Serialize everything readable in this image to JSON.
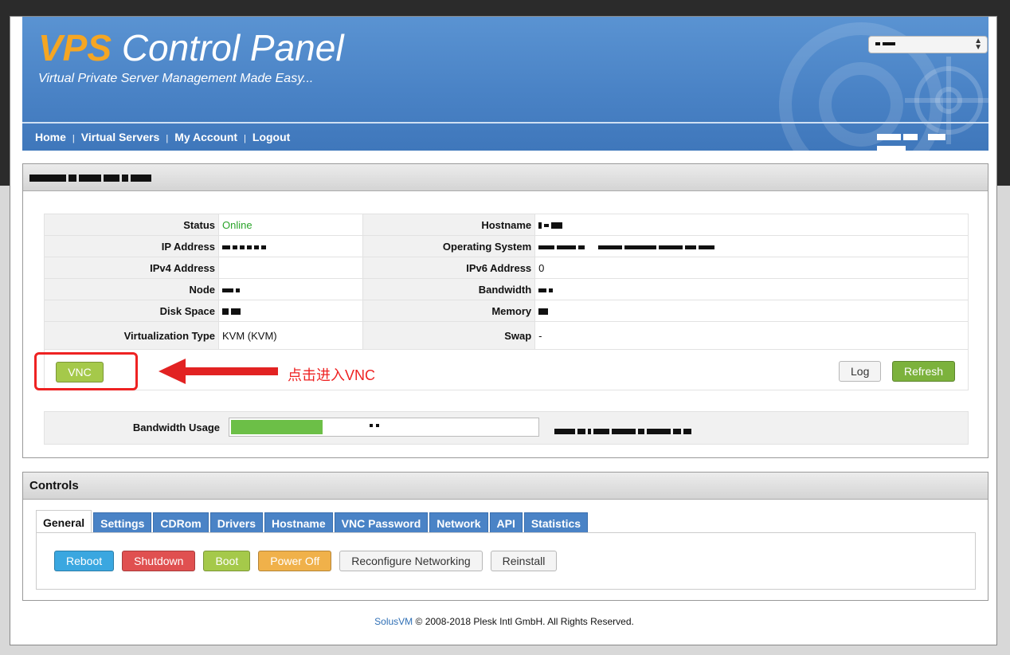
{
  "header": {
    "title_prefix": "VPS",
    "title_rest": " Control Panel",
    "subtitle": "Virtual Private Server Management Made Easy..."
  },
  "nav": {
    "items": [
      "Home",
      "Virtual Servers",
      "My Account",
      "Logout"
    ]
  },
  "server": {
    "left": [
      {
        "label": "Status",
        "value": "Online"
      },
      {
        "label": "IP Address",
        "value": ""
      },
      {
        "label": "IPv4 Address",
        "value": ""
      },
      {
        "label": "Node",
        "value": ""
      },
      {
        "label": "Disk Space",
        "value": ""
      },
      {
        "label": "Virtualization Type",
        "value": "KVM  (KVM)"
      }
    ],
    "right": [
      {
        "label": "Hostname",
        "value": ""
      },
      {
        "label": "Operating System",
        "value": ""
      },
      {
        "label": "IPv6 Address",
        "value": "0"
      },
      {
        "label": "Bandwidth",
        "value": ""
      },
      {
        "label": "Memory",
        "value": ""
      },
      {
        "label": "Swap",
        "value": "-"
      }
    ],
    "vnc_label": "VNC",
    "log_label": "Log",
    "refresh_label": "Refresh",
    "annotation": "点击进入VNC",
    "bandwidth_label": "Bandwidth Usage",
    "bandwidth_percent": 30
  },
  "controls": {
    "title": "Controls",
    "tabs": [
      "General",
      "Settings",
      "CDRom",
      "Drivers",
      "Hostname",
      "VNC Password",
      "Network",
      "API",
      "Statistics"
    ],
    "buttons": {
      "reboot": "Reboot",
      "shutdown": "Shutdown",
      "boot": "Boot",
      "poweroff": "Power Off",
      "reconfigure": "Reconfigure Networking",
      "reinstall": "Reinstall"
    }
  },
  "footer": {
    "brand": "SolusVM",
    "text": " © 2008-2018 Plesk Intl GmbH. All Rights Reserved."
  },
  "colors": {
    "header_blue": "#4a83c6",
    "online_green": "#2aa42a",
    "accent_orange": "#f5a623",
    "annotation_red": "#e22222"
  }
}
